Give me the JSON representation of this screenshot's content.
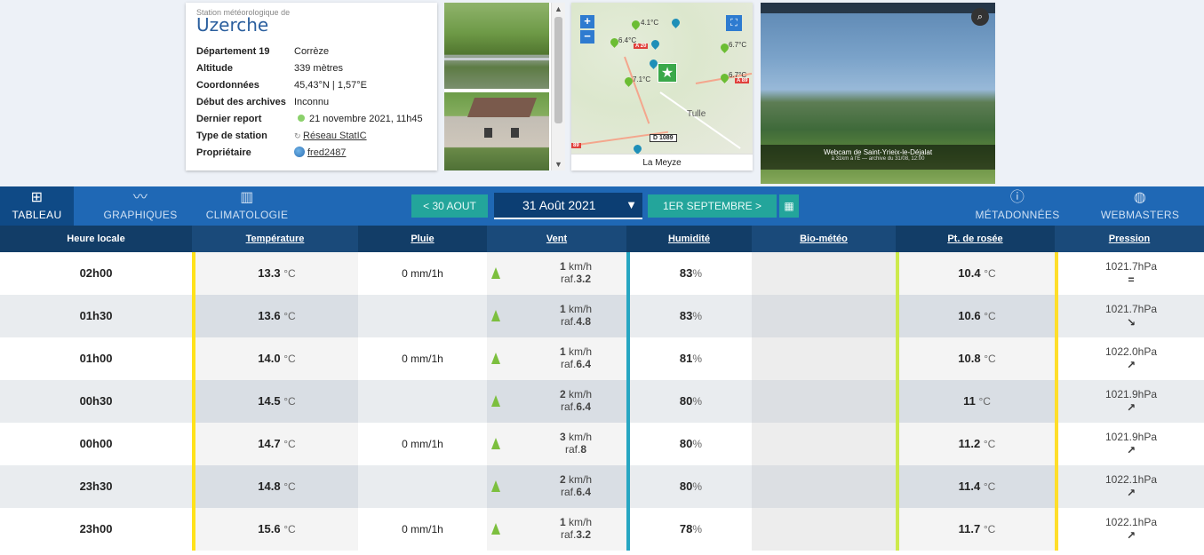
{
  "station": {
    "subtitle": "Station météorologique de",
    "name": "Uzerche",
    "fields": [
      {
        "key": "Département 19",
        "value": "Corrèze"
      },
      {
        "key": "Altitude",
        "value": "339 mètres"
      },
      {
        "key": "Coordonnées",
        "value": "45,43°N | 1,57°E"
      },
      {
        "key": "Début des archives",
        "value": "Inconnu"
      },
      {
        "key": "Dernier report",
        "value": "21 novembre 2021, 11h45"
      },
      {
        "key": "Type de station",
        "value": "Réseau StatIC"
      },
      {
        "key": "Propriétaire",
        "value": "fred2487"
      }
    ]
  },
  "map": {
    "caption": "La Meyze",
    "zoom_in": "+",
    "zoom_out": "−",
    "city_label": "Tulle",
    "route": "D 1089",
    "temps": [
      "4.1°C",
      "6.4°C",
      "6.7°C",
      "7.1°C",
      "6.7°C"
    ],
    "road_tags": [
      "A 20",
      "A 89",
      "89"
    ]
  },
  "webcam": {
    "caption_line1": "Webcam de Saint-Yrieix-le-Déjalat",
    "caption_line2": "à 31km à l'E — archive du 31/08, 12:00"
  },
  "nav": {
    "tabs": [
      {
        "label": "TABLEAU",
        "icon": "table-icon"
      },
      {
        "label": "GRAPHIQUES",
        "icon": "line-chart-icon"
      },
      {
        "label": "CLIMATOLOGIE",
        "icon": "bar-chart-icon"
      },
      {
        "label": "MÉTADONNÉES",
        "icon": "info-icon"
      },
      {
        "label": "WEBMASTERS",
        "icon": "globe-icon"
      }
    ],
    "prev": "< 30 AOUT",
    "current_date": "31 Août 2021",
    "next": "1ER SEPTEMBRE >",
    "calendar_icon": "calendar-icon"
  },
  "table": {
    "headers": [
      "Heure locale",
      "Température",
      "Pluie",
      "Vent",
      "Humidité",
      "Bio-météo",
      "Pt. de rosée",
      "Pression"
    ],
    "units": {
      "temp": "°C",
      "wind": "km/h",
      "gust_prefix": "raf.",
      "hum": "%",
      "pres": "hPa"
    },
    "rows": [
      {
        "hour": "02h00",
        "temp": "13.3",
        "rain": "0 mm/1h",
        "wind": "1",
        "gust": "3.2",
        "hum": "83",
        "dew": "10.4",
        "pres": "1021.7",
        "trend": "="
      },
      {
        "hour": "01h30",
        "temp": "13.6",
        "rain": "",
        "wind": "1",
        "gust": "4.8",
        "hum": "83",
        "dew": "10.6",
        "pres": "1021.7",
        "trend": "↘"
      },
      {
        "hour": "01h00",
        "temp": "14.0",
        "rain": "0 mm/1h",
        "wind": "1",
        "gust": "6.4",
        "hum": "81",
        "dew": "10.8",
        "pres": "1022.0",
        "trend": "↗"
      },
      {
        "hour": "00h30",
        "temp": "14.5",
        "rain": "",
        "wind": "2",
        "gust": "6.4",
        "hum": "80",
        "dew": "11",
        "pres": "1021.9",
        "trend": "↗"
      },
      {
        "hour": "00h00",
        "temp": "14.7",
        "rain": "0 mm/1h",
        "wind": "3",
        "gust": "8",
        "hum": "80",
        "dew": "11.2",
        "pres": "1021.9",
        "trend": "↗"
      },
      {
        "hour": "23h30",
        "temp": "14.8",
        "rain": "",
        "wind": "2",
        "gust": "6.4",
        "hum": "80",
        "dew": "11.4",
        "pres": "1022.1",
        "trend": "↗"
      },
      {
        "hour": "23h00",
        "temp": "15.6",
        "rain": "0 mm/1h",
        "wind": "1",
        "gust": "3.2",
        "hum": "78",
        "dew": "11.7",
        "pres": "1022.1",
        "trend": "↗"
      }
    ]
  },
  "colors": {
    "nav_bg": "#1f68b5",
    "header_bg": "#123d67",
    "teal": "#23a59b",
    "temp_bar": "#ffe21b",
    "hum_bar": "#27a6c2",
    "dew_bar": "#cdea4c",
    "pres_bar": "#ffde2a"
  }
}
